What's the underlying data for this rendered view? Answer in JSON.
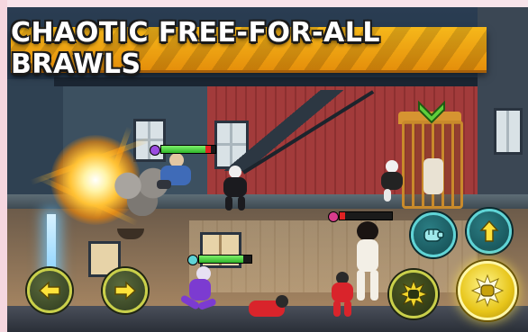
{
  "banner": {
    "text": "CHAOTIC FREE-FOR-ALL BRAWLS"
  },
  "colors": {
    "banner": "#f0a816",
    "health_fill": "#3fd13a",
    "health_damage": "#e12222",
    "control_ring_yellow": "#c9d04a",
    "control_ring_teal": "#5fd4d6"
  },
  "health_bars": [
    {
      "id": "enemy-left",
      "level": 0.82
    },
    {
      "id": "player",
      "level": 0.84
    },
    {
      "id": "enemy-right",
      "level": 0.1
    }
  ],
  "controls": {
    "left": {
      "icon": "arrow-left-icon"
    },
    "right": {
      "icon": "arrow-right-icon"
    },
    "grab": {
      "icon": "fist-icon"
    },
    "jump": {
      "icon": "arrow-up-icon"
    },
    "special": {
      "icon": "burst-fist-icon"
    },
    "punch": {
      "icon": "punch-icon"
    }
  },
  "indicators": {
    "target": {
      "icon": "chevron-down-icon"
    }
  }
}
